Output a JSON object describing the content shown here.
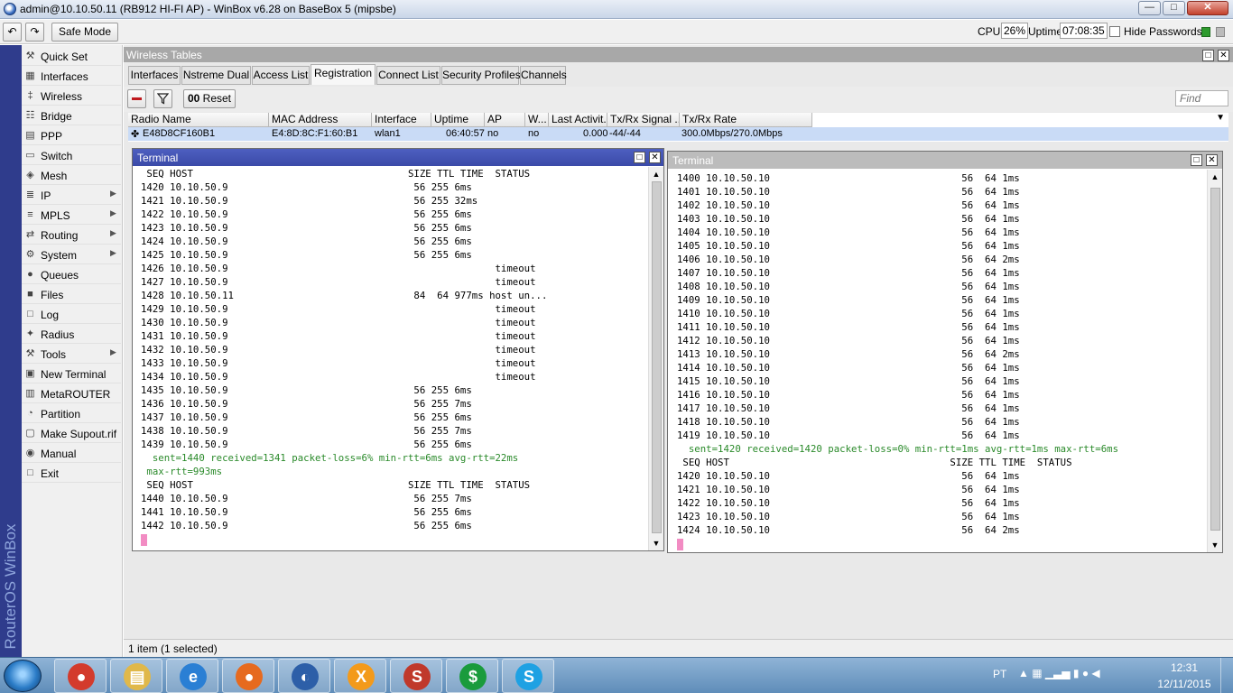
{
  "window": {
    "title": "admin@10.10.50.11 (RB912 HI-FI AP) - WinBox v6.28 on BaseBox 5 (mipsbe)",
    "min": "—",
    "max": "□",
    "close": "✕"
  },
  "toolbar": {
    "undo": "↶",
    "redo": "↷",
    "safe_mode": "Safe Mode",
    "cpu_label": "CPU:",
    "cpu_value": "26%",
    "uptime_label": "Uptime:",
    "uptime_value": "07:08:35",
    "hide_passwords": "Hide Passwords"
  },
  "brand": "RouterOS WinBox",
  "sidebar": {
    "items": [
      {
        "label": "Quick Set",
        "icon": "quick-set-icon",
        "glyph": "⚒",
        "arrow": false
      },
      {
        "label": "Interfaces",
        "icon": "interfaces-icon",
        "glyph": "▦",
        "arrow": false
      },
      {
        "label": "Wireless",
        "icon": "wireless-icon",
        "glyph": "‡",
        "arrow": false
      },
      {
        "label": "Bridge",
        "icon": "bridge-icon",
        "glyph": "☷",
        "arrow": false
      },
      {
        "label": "PPP",
        "icon": "ppp-icon",
        "glyph": "▤",
        "arrow": false
      },
      {
        "label": "Switch",
        "icon": "switch-icon",
        "glyph": "▭",
        "arrow": false
      },
      {
        "label": "Mesh",
        "icon": "mesh-icon",
        "glyph": "◈",
        "arrow": false
      },
      {
        "label": "IP",
        "icon": "ip-icon",
        "glyph": "≣",
        "arrow": true
      },
      {
        "label": "MPLS",
        "icon": "mpls-icon",
        "glyph": "≡",
        "arrow": true
      },
      {
        "label": "Routing",
        "icon": "routing-icon",
        "glyph": "⇄",
        "arrow": true
      },
      {
        "label": "System",
        "icon": "system-icon",
        "glyph": "⚙",
        "arrow": true
      },
      {
        "label": "Queues",
        "icon": "queues-icon",
        "glyph": "●",
        "arrow": false
      },
      {
        "label": "Files",
        "icon": "files-icon",
        "glyph": "■",
        "arrow": false
      },
      {
        "label": "Log",
        "icon": "log-icon",
        "glyph": "□",
        "arrow": false
      },
      {
        "label": "Radius",
        "icon": "radius-icon",
        "glyph": "✦",
        "arrow": false
      },
      {
        "label": "Tools",
        "icon": "tools-icon",
        "glyph": "⚒",
        "arrow": true
      },
      {
        "label": "New Terminal",
        "icon": "terminal-icon",
        "glyph": "▣",
        "arrow": false
      },
      {
        "label": "MetaROUTER",
        "icon": "metarouter-icon",
        "glyph": "▥",
        "arrow": false
      },
      {
        "label": "Partition",
        "icon": "partition-icon",
        "glyph": "◔",
        "arrow": false
      },
      {
        "label": "Make Supout.rif",
        "icon": "supout-icon",
        "glyph": "▢",
        "arrow": false
      },
      {
        "label": "Manual",
        "icon": "manual-icon",
        "glyph": "◉",
        "arrow": false
      },
      {
        "label": "Exit",
        "icon": "exit-icon",
        "glyph": "□",
        "arrow": false
      }
    ]
  },
  "wireless_tables": {
    "title": "Wireless Tables",
    "tabs": [
      "Interfaces",
      "Nstreme Dual",
      "Access List",
      "Registration",
      "Connect List",
      "Security Profiles",
      "Channels"
    ],
    "active_tab": "Registration",
    "reset_label": "Reset",
    "find_placeholder": "Find",
    "columns": [
      "Radio Name",
      "MAC Address",
      "Interface",
      "Uptime",
      "AP",
      "W...",
      "Last Activit...",
      "Tx/Rx Signal ...",
      "Tx/Rx Rate"
    ],
    "row": {
      "radio_name": "E48D8CF160B1",
      "mac": "E4:8D:8C:F1:60:B1",
      "interface": "wlan1",
      "uptime": "06:40:57",
      "ap": "no",
      "w": "no",
      "last_activity": "0.000",
      "signal": "-44/-44",
      "rate": "300.0Mbps/270.0Mbps"
    },
    "status": "1 item (1 selected)"
  },
  "terminal1": {
    "title": "Terminal",
    "lines": [
      {
        "text": " SEQ HOST                                     SIZE TTL TIME  STATUS",
        "green": false
      },
      {
        "text": "1420 10.10.50.9                                56 255 6ms",
        "green": false
      },
      {
        "text": "1421 10.10.50.9                                56 255 32ms",
        "green": false
      },
      {
        "text": "1422 10.10.50.9                                56 255 6ms",
        "green": false
      },
      {
        "text": "1423 10.10.50.9                                56 255 6ms",
        "green": false
      },
      {
        "text": "1424 10.10.50.9                                56 255 6ms",
        "green": false
      },
      {
        "text": "1425 10.10.50.9                                56 255 6ms",
        "green": false
      },
      {
        "text": "1426 10.10.50.9                                              timeout",
        "green": false
      },
      {
        "text": "1427 10.10.50.9                                              timeout",
        "green": false
      },
      {
        "text": "1428 10.10.50.11                               84  64 977ms host un...",
        "green": false
      },
      {
        "text": "1429 10.10.50.9                                              timeout",
        "green": false
      },
      {
        "text": "1430 10.10.50.9                                              timeout",
        "green": false
      },
      {
        "text": "1431 10.10.50.9                                              timeout",
        "green": false
      },
      {
        "text": "1432 10.10.50.9                                              timeout",
        "green": false
      },
      {
        "text": "1433 10.10.50.9                                              timeout",
        "green": false
      },
      {
        "text": "1434 10.10.50.9                                              timeout",
        "green": false
      },
      {
        "text": "1435 10.10.50.9                                56 255 6ms",
        "green": false
      },
      {
        "text": "1436 10.10.50.9                                56 255 7ms",
        "green": false
      },
      {
        "text": "1437 10.10.50.9                                56 255 6ms",
        "green": false
      },
      {
        "text": "1438 10.10.50.9                                56 255 7ms",
        "green": false
      },
      {
        "text": "1439 10.10.50.9                                56 255 6ms",
        "green": false
      },
      {
        "text": "  sent=1440 received=1341 packet-loss=6% min-rtt=6ms avg-rtt=22ms",
        "green": true
      },
      {
        "text": " max-rtt=993ms",
        "green": true
      },
      {
        "text": " SEQ HOST                                     SIZE TTL TIME  STATUS",
        "green": false
      },
      {
        "text": "1440 10.10.50.9                                56 255 7ms",
        "green": false
      },
      {
        "text": "1441 10.10.50.9                                56 255 6ms",
        "green": false
      },
      {
        "text": "1442 10.10.50.9                                56 255 6ms",
        "green": false
      }
    ]
  },
  "terminal2": {
    "title": "Terminal",
    "lines": [
      {
        "text": "1400 10.10.50.10                                 56  64 1ms",
        "green": false
      },
      {
        "text": "1401 10.10.50.10                                 56  64 1ms",
        "green": false
      },
      {
        "text": "1402 10.10.50.10                                 56  64 1ms",
        "green": false
      },
      {
        "text": "1403 10.10.50.10                                 56  64 1ms",
        "green": false
      },
      {
        "text": "1404 10.10.50.10                                 56  64 1ms",
        "green": false
      },
      {
        "text": "1405 10.10.50.10                                 56  64 1ms",
        "green": false
      },
      {
        "text": "1406 10.10.50.10                                 56  64 2ms",
        "green": false
      },
      {
        "text": "1407 10.10.50.10                                 56  64 1ms",
        "green": false
      },
      {
        "text": "1408 10.10.50.10                                 56  64 1ms",
        "green": false
      },
      {
        "text": "1409 10.10.50.10                                 56  64 1ms",
        "green": false
      },
      {
        "text": "1410 10.10.50.10                                 56  64 1ms",
        "green": false
      },
      {
        "text": "1411 10.10.50.10                                 56  64 1ms",
        "green": false
      },
      {
        "text": "1412 10.10.50.10                                 56  64 1ms",
        "green": false
      },
      {
        "text": "1413 10.10.50.10                                 56  64 2ms",
        "green": false
      },
      {
        "text": "1414 10.10.50.10                                 56  64 1ms",
        "green": false
      },
      {
        "text": "1415 10.10.50.10                                 56  64 1ms",
        "green": false
      },
      {
        "text": "1416 10.10.50.10                                 56  64 1ms",
        "green": false
      },
      {
        "text": "1417 10.10.50.10                                 56  64 1ms",
        "green": false
      },
      {
        "text": "1418 10.10.50.10                                 56  64 1ms",
        "green": false
      },
      {
        "text": "1419 10.10.50.10                                 56  64 1ms",
        "green": false
      },
      {
        "text": "  sent=1420 received=1420 packet-loss=0% min-rtt=1ms avg-rtt=1ms max-rtt=6ms",
        "green": true
      },
      {
        "text": " SEQ HOST                                      SIZE TTL TIME  STATUS",
        "green": false
      },
      {
        "text": "1420 10.10.50.10                                 56  64 1ms",
        "green": false
      },
      {
        "text": "1421 10.10.50.10                                 56  64 1ms",
        "green": false
      },
      {
        "text": "1422 10.10.50.10                                 56  64 1ms",
        "green": false
      },
      {
        "text": "1423 10.10.50.10                                 56  64 1ms",
        "green": false
      },
      {
        "text": "1424 10.10.50.10                                 56  64 2ms",
        "green": false
      }
    ]
  },
  "taskbar": {
    "apps": [
      {
        "name": "chrome",
        "glyph": "●",
        "color": "#d33b2c"
      },
      {
        "name": "file-explorer",
        "glyph": "▤",
        "color": "#e0b84a"
      },
      {
        "name": "internet-explorer",
        "glyph": "e",
        "color": "#2a7fd4"
      },
      {
        "name": "firefox",
        "glyph": "●",
        "color": "#e66a1f"
      },
      {
        "name": "winbox",
        "glyph": "◐",
        "color": "#2d5fa8"
      },
      {
        "name": "xampp",
        "glyph": "X",
        "color": "#f39a1b"
      },
      {
        "name": "sqldeveloper",
        "glyph": "S",
        "color": "#c0392b"
      },
      {
        "name": "dollar-app",
        "glyph": "$",
        "color": "#1a9b3c"
      },
      {
        "name": "skype",
        "glyph": "S",
        "color": "#1ea1e3"
      }
    ],
    "lang": "PT",
    "tray": "▲  ▦  ▁▃▅  ▮  ●  ◀",
    "time": "12:31",
    "date": "12/11/2015"
  }
}
